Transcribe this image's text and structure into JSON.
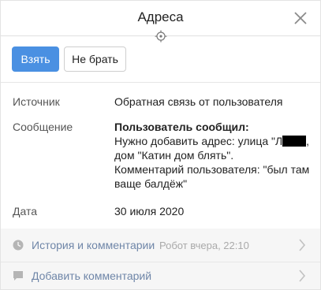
{
  "header": {
    "title": "Адреса"
  },
  "toolbar": {
    "take_label": "Взять",
    "skip_label": "Не брать"
  },
  "details": {
    "source_label": "Источник",
    "source_value": "Обратная связь от пользователя",
    "message_label": "Сообщение",
    "message_title": "Пользователь сообщил:",
    "message_line1_prefix": "Нужно добавить адрес: улица \"Л",
    "message_line1_suffix": ",",
    "message_line2": "дом \"Катин дом блять\".",
    "message_line3": "Комментарий пользователя: \"был там",
    "message_line4": "ваще балдёж\"",
    "date_label": "Дата",
    "date_value": "30 июля 2020"
  },
  "footer": {
    "history_label": "История и комментарии",
    "history_meta": "Робот вчера, 22:10",
    "add_comment_label": "Добавить комментарий"
  },
  "icons": {
    "close": "close-icon",
    "target": "target-icon",
    "clock": "clock-icon",
    "comment": "comment-icon",
    "chevron": "chevron-right-icon"
  },
  "colors": {
    "primary": "#4a90e2",
    "link": "#6f86a8",
    "footer_bg": "#f6f6f6"
  }
}
